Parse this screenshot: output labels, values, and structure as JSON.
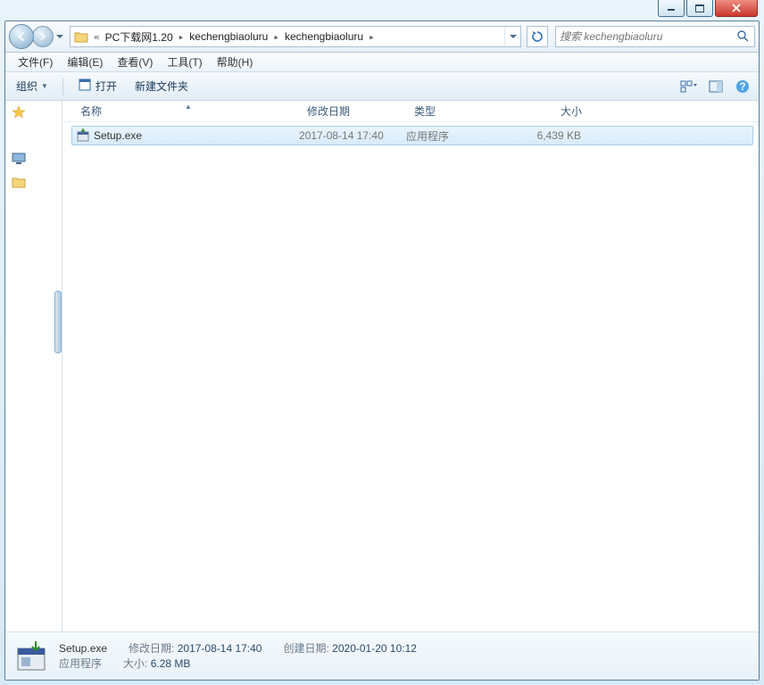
{
  "breadcrumbs": {
    "prefix": "«",
    "items": [
      "PC下载网1.20",
      "kechengbiaoluru",
      "kechengbiaoluru"
    ]
  },
  "search": {
    "placeholder": "搜索 kechengbiaoluru"
  },
  "menu": {
    "file": "文件(F)",
    "edit": "编辑(E)",
    "view": "查看(V)",
    "tools": "工具(T)",
    "help": "帮助(H)"
  },
  "toolbar": {
    "organize": "组织",
    "open": "打开",
    "newfolder": "新建文件夹"
  },
  "columns": {
    "name": "名称",
    "modified": "修改日期",
    "type": "类型",
    "size": "大小"
  },
  "files": [
    {
      "name": "Setup.exe",
      "modified": "2017-08-14 17:40",
      "type": "应用程序",
      "size": "6,439 KB"
    }
  ],
  "details": {
    "filename": "Setup.exe",
    "filetype": "应用程序",
    "mod_label": "修改日期:",
    "mod_value": "2017-08-14 17:40",
    "size_label": "大小:",
    "size_value": "6.28 MB",
    "created_label": "创建日期:",
    "created_value": "2020-01-20 10:12"
  }
}
